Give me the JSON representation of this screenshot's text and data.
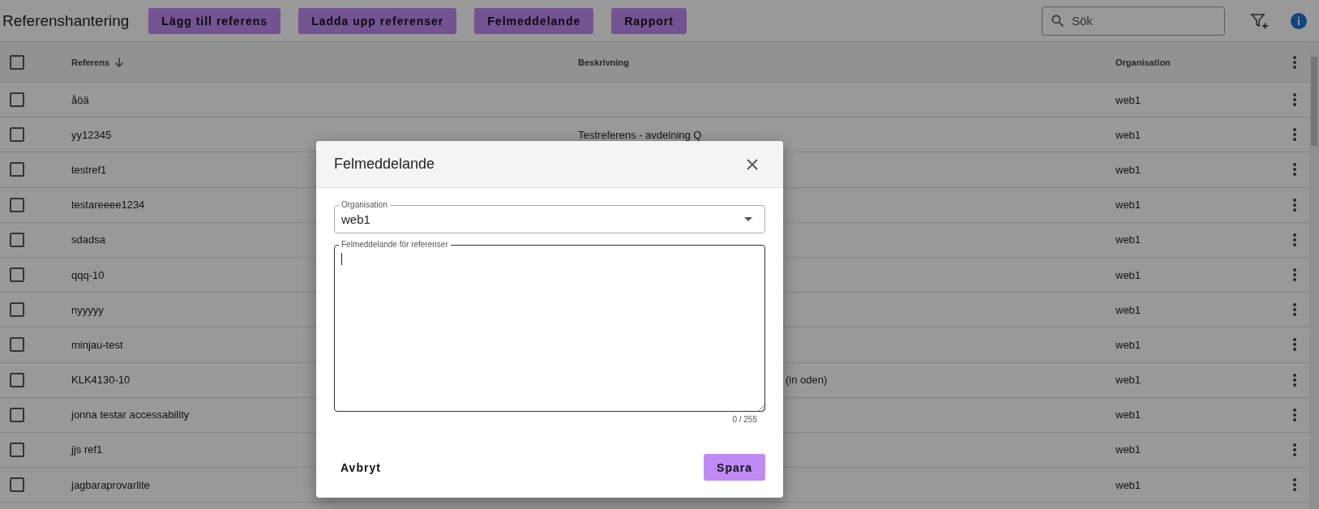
{
  "page": {
    "title": "Referenshantering"
  },
  "toolbar": {
    "buttons": [
      "Lägg till referens",
      "Ladda upp referenser",
      "Felmeddelande",
      "Rapport"
    ],
    "search": {
      "placeholder": "Sök"
    }
  },
  "table": {
    "select_all": {
      "checked": false
    },
    "columns": [
      {
        "label": "Referens",
        "sorted": true
      },
      {
        "label": "Beskrivning",
        "sorted": false
      },
      {
        "label": "Organisation",
        "sorted": false
      }
    ],
    "rows": [
      {
        "checked": false,
        "reference": "åöä",
        "organisation": "web1"
      },
      {
        "checked": false,
        "reference": "yy12345",
        "description": "Testreferens - avdelning Q",
        "organisation": "web1"
      },
      {
        "checked": false,
        "reference": "testref1",
        "organisation": "web1"
      },
      {
        "checked": false,
        "reference": "testareeee1234",
        "organisation": "web1"
      },
      {
        "checked": false,
        "reference": "sdadsa",
        "organisation": "web1"
      },
      {
        "checked": false,
        "reference": "qqq-10",
        "organisation": "web1"
      },
      {
        "checked": false,
        "reference": "nyyyyy",
        "organisation": "web1"
      },
      {
        "checked": false,
        "reference": "minjau-test",
        "organisation": "web1"
      },
      {
        "checked": false,
        "reference": "KLK4130-10",
        "description": "(in oden)",
        "description_hidden_start": true,
        "organisation": "web1"
      },
      {
        "checked": false,
        "reference": "jonna testar accessability",
        "organisation": "web1"
      },
      {
        "checked": false,
        "reference": "jjs ref1",
        "organisation": "web1"
      },
      {
        "checked": false,
        "reference": "jagbaraprovarlite",
        "organisation": "web1"
      }
    ]
  },
  "dialog": {
    "title": "Felmeddelande",
    "organisation_select": {
      "label": "Organisation",
      "value": "web1"
    },
    "message_field": {
      "label": "Felmeddelande för referenser",
      "focused": true,
      "counter": "0 / 255"
    },
    "buttons": [
      {
        "label": "Avbryt",
        "kind": "text"
      },
      {
        "label": "Spara",
        "kind": "primary"
      }
    ]
  }
}
